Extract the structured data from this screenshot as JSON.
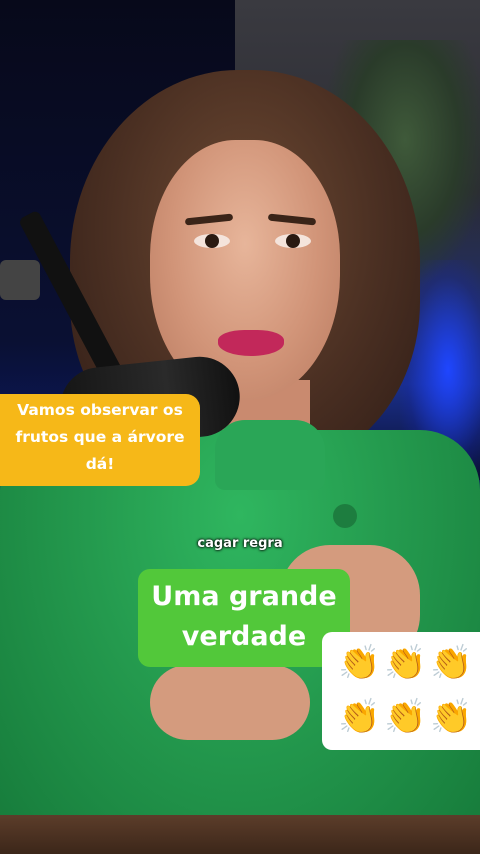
{
  "captions": {
    "top_banner_lines": [
      "Vamos observar os",
      "frutos que a árvore",
      "dá!"
    ],
    "small_label": "cagar regra",
    "main_lines": [
      "Uma grande",
      "verdade"
    ]
  },
  "sticker": {
    "icon": "clapping-hands-emoji",
    "glyph": "👏",
    "count": 6
  },
  "colors": {
    "banner_yellow": "#f6b818",
    "banner_green": "#52c83a",
    "shirt_green": "#249a4e"
  }
}
